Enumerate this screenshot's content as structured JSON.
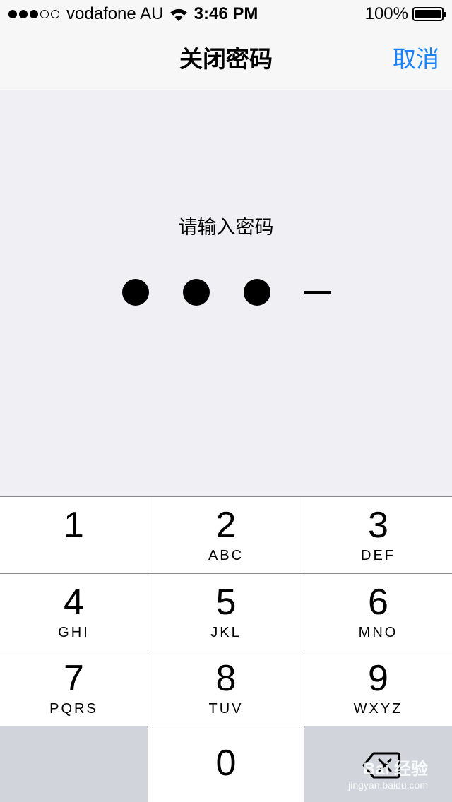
{
  "status_bar": {
    "signal": "●●●○○",
    "carrier": "vodafone AU",
    "time": "3:46 PM",
    "battery_percent": "100%",
    "battery_level": 1.0
  },
  "nav": {
    "title": "关闭密码",
    "cancel_label": "取消",
    "accent_color": "#1a82fb"
  },
  "passcode": {
    "prompt": "请输入密码",
    "entered_digits": 3,
    "total_digits": 4
  },
  "keypad": {
    "keys": [
      {
        "digit": "1",
        "letters": ""
      },
      {
        "digit": "2",
        "letters": "ABC"
      },
      {
        "digit": "3",
        "letters": "DEF"
      },
      {
        "digit": "4",
        "letters": "GHI"
      },
      {
        "digit": "5",
        "letters": "JKL"
      },
      {
        "digit": "6",
        "letters": "MNO"
      },
      {
        "digit": "7",
        "letters": "PQRS"
      },
      {
        "digit": "8",
        "letters": "TUV"
      },
      {
        "digit": "9",
        "letters": "WXYZ"
      },
      {
        "digit": "0",
        "letters": ""
      }
    ],
    "delete_icon": "backspace-icon"
  },
  "watermark": {
    "brand": "Bai 经验",
    "site": "jingyan.baidu.com"
  }
}
